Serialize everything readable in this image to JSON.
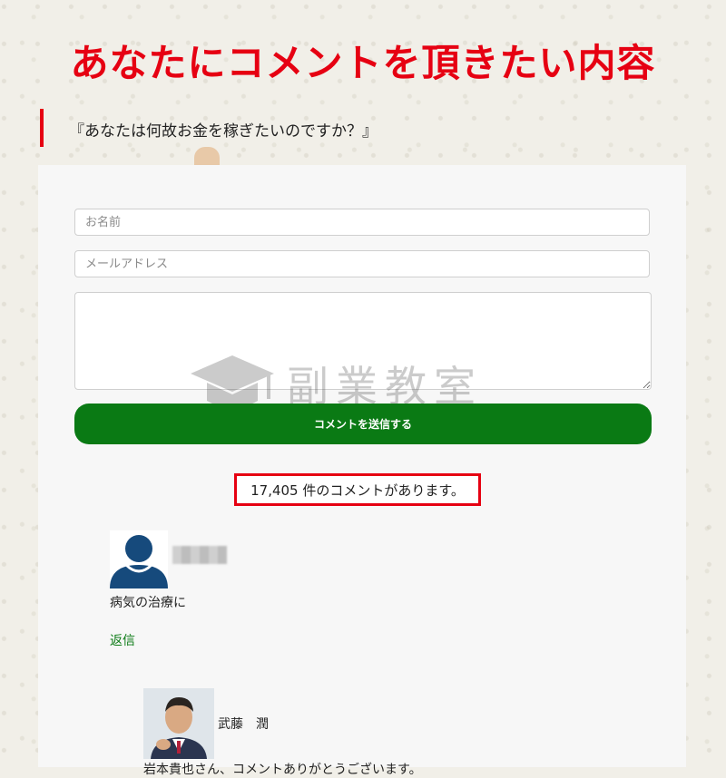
{
  "page": {
    "title": "あなたにコメントを頂きたい内容",
    "question": "『あなたは何故お金を稼ぎたいのですか？』"
  },
  "form": {
    "name_placeholder": "お名前",
    "email_placeholder": "メールアドレス",
    "message_placeholder": "",
    "submit_label": "コメントを送信する"
  },
  "watermark": {
    "text": "副業教室"
  },
  "comments": {
    "count_text": "17,405 件のコメントがあります。",
    "items": [
      {
        "text": "病気の治療に",
        "reply_label": "返信",
        "avatar": "person-silhouette-icon"
      }
    ],
    "replies": [
      {
        "author": "武藤　潤",
        "text": "岩本貴也さん、コメントありがとうございます。",
        "avatar": "author-photo"
      }
    ]
  },
  "colors": {
    "title_red": "#e60012",
    "submit_green": "#0a7a14",
    "avatar_blue": "#164a7c"
  }
}
